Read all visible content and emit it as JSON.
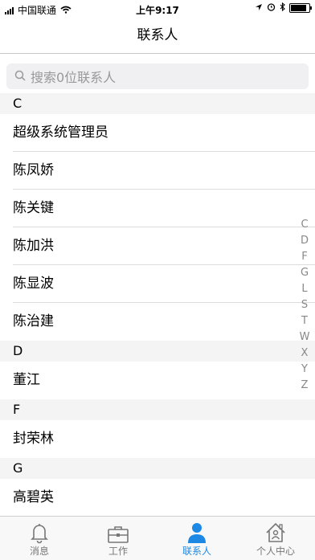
{
  "status_bar": {
    "carrier": "中国联通",
    "time": "上午9:17",
    "battery_level": 0.85
  },
  "navbar": {
    "title": "联系人"
  },
  "search": {
    "placeholder": "搜索0位联系人"
  },
  "sections": [
    {
      "letter": "C",
      "contacts": [
        "超级系统管理员",
        "陈凤娇",
        "陈关键",
        "陈加洪",
        "陈显波",
        "陈治建"
      ]
    },
    {
      "letter": "D",
      "contacts": [
        "董江"
      ]
    },
    {
      "letter": "F",
      "contacts": [
        "封荣林"
      ]
    },
    {
      "letter": "G",
      "contacts": [
        "高碧英"
      ]
    }
  ],
  "index_letters": [
    "C",
    "D",
    "F",
    "G",
    "L",
    "S",
    "T",
    "W",
    "X",
    "Y",
    "Z"
  ],
  "tabs": [
    {
      "label": "消息",
      "icon": "bell-icon"
    },
    {
      "label": "工作",
      "icon": "briefcase-icon"
    },
    {
      "label": "联系人",
      "icon": "person-icon",
      "active": true
    },
    {
      "label": "个人中心",
      "icon": "house-icon"
    }
  ],
  "colors": {
    "accent": "#1e88e5"
  }
}
